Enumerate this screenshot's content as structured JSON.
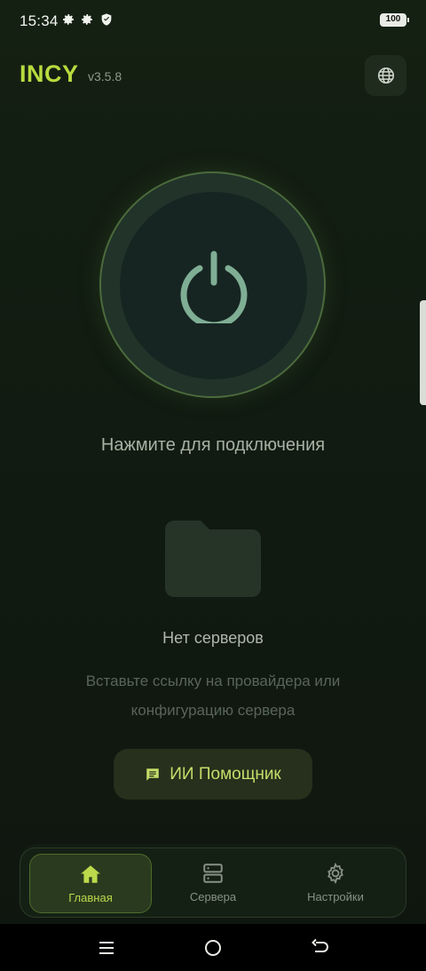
{
  "status_bar": {
    "time": "15:34",
    "battery": "100"
  },
  "header": {
    "brand": "INCY",
    "version": "v3.5.8"
  },
  "connect": {
    "prompt": "Нажмите для подключения"
  },
  "empty_state": {
    "title": "Нет серверов",
    "description": "Вставьте ссылку на провайдера или конфигурацию сервера"
  },
  "ai_button": {
    "label": "ИИ Помощник"
  },
  "bottom_nav": {
    "items": [
      {
        "label": "Главная",
        "icon": "home-icon",
        "active": true
      },
      {
        "label": "Сервера",
        "icon": "servers-icon",
        "active": false
      },
      {
        "label": "Настройки",
        "icon": "gear-icon",
        "active": false
      }
    ]
  },
  "colors": {
    "accent": "#b7db3e",
    "background": "#111b11",
    "power_ring": "#4b6b3b",
    "power_glyph": "#7fae95"
  }
}
